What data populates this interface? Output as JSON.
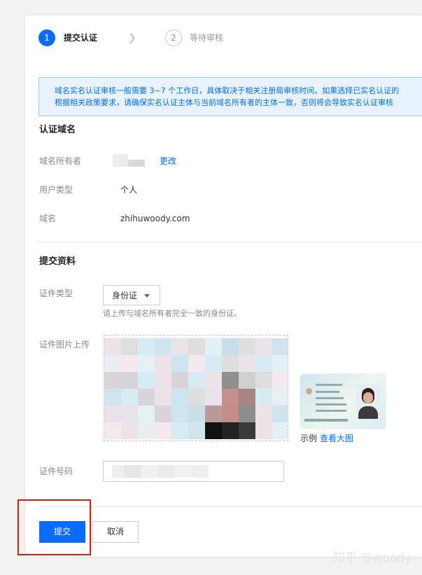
{
  "steps": [
    {
      "number": "1",
      "label": "提交认证",
      "active": true
    },
    {
      "number": "2",
      "label": "等待审核",
      "active": false
    }
  ],
  "notice": {
    "line1": "域名实名认证审核一般需要 3~7 个工作日，具体取决于相关注册局审核时间。如果选择已实名认证的",
    "line2": "根据相关政策要求，请确保实名认证主体与当前域名所有者的主体一致，否则将会导致实名认证审核"
  },
  "domain_section": {
    "title": "认证域名",
    "owner_label": "域名所有者",
    "change_link": "更改",
    "user_type_label": "用户类型",
    "user_type_value": "个人",
    "domain_label": "域名",
    "domain_value": "zhihuwoody.com"
  },
  "submit_section": {
    "title": "提交资料",
    "cert_type_label": "证件类型",
    "cert_type_value": "身份证",
    "cert_hint": "请上传与域名所有者完全一致的身份证。",
    "upload_label": "证件图片上传",
    "sample_label": "示例",
    "sample_link": "查看大图",
    "id_number_label": "证件号码"
  },
  "buttons": {
    "submit": "提交",
    "cancel": "取消"
  },
  "watermark": "知乎 @woody",
  "colors": {
    "accent": "#0a6cff",
    "notice_bg": "#e9f3ff",
    "highlight_box": "#d81e06"
  }
}
